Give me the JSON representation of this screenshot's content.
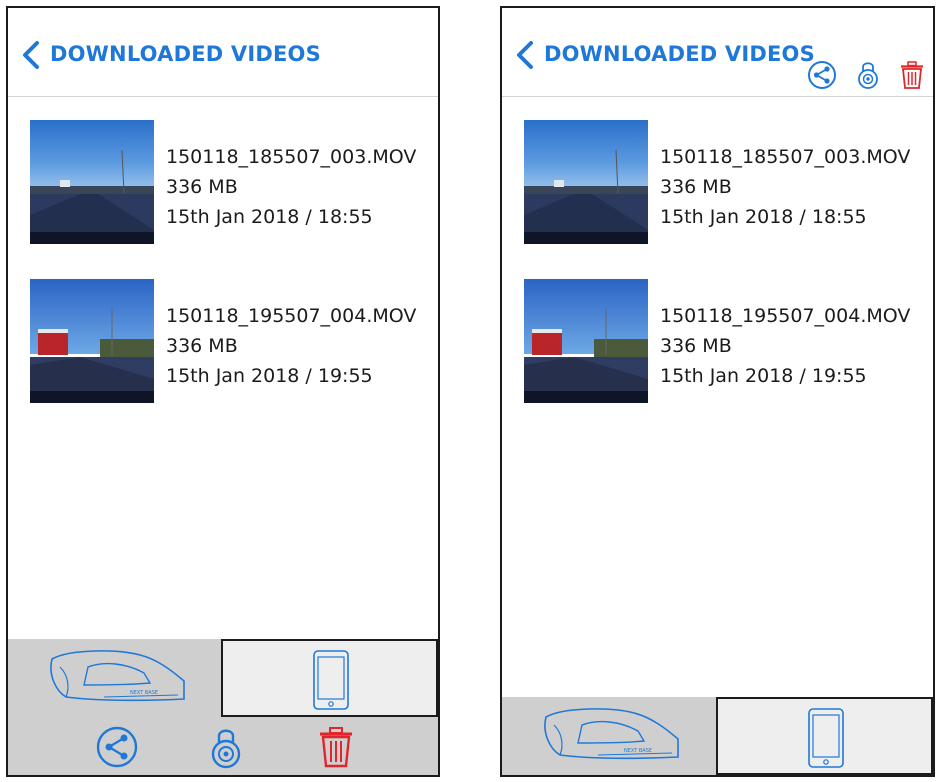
{
  "screens": [
    {
      "header": {
        "title": "DOWNLOADED VIDEOS"
      },
      "videos": [
        {
          "filename": "150118_185507_003.MOV",
          "size": "336 MB",
          "datetime": "15th Jan 2018 / 18:55"
        },
        {
          "filename": "150118_195507_004.MOV",
          "size": "336 MB",
          "datetime": "15th Jan 2018 / 19:55"
        }
      ],
      "bottom_tabs": [
        {
          "icon": "dashcam-icon",
          "active": true
        },
        {
          "icon": "phone-icon",
          "active": false
        }
      ],
      "action_bar": [
        {
          "icon": "share-icon"
        },
        {
          "icon": "lock-icon"
        },
        {
          "icon": "trash-icon"
        }
      ]
    },
    {
      "header": {
        "title": "DOWNLOADED VIDEOS",
        "icons": [
          "share-icon",
          "lock-icon",
          "trash-icon"
        ]
      },
      "videos": [
        {
          "filename": "150118_185507_003.MOV",
          "size": "336 MB",
          "datetime": "15th Jan 2018 / 18:55"
        },
        {
          "filename": "150118_195507_004.MOV",
          "size": "336 MB",
          "datetime": "15th Jan 2018 / 19:55"
        }
      ],
      "bottom_tabs": [
        {
          "icon": "dashcam-icon",
          "active": true
        },
        {
          "icon": "phone-icon",
          "active": false
        }
      ]
    }
  ],
  "colors": {
    "accent": "#1f78d8",
    "delete": "#e0262a",
    "tab_active": "#cfcfcf",
    "tab_inactive": "#eeeeee"
  }
}
